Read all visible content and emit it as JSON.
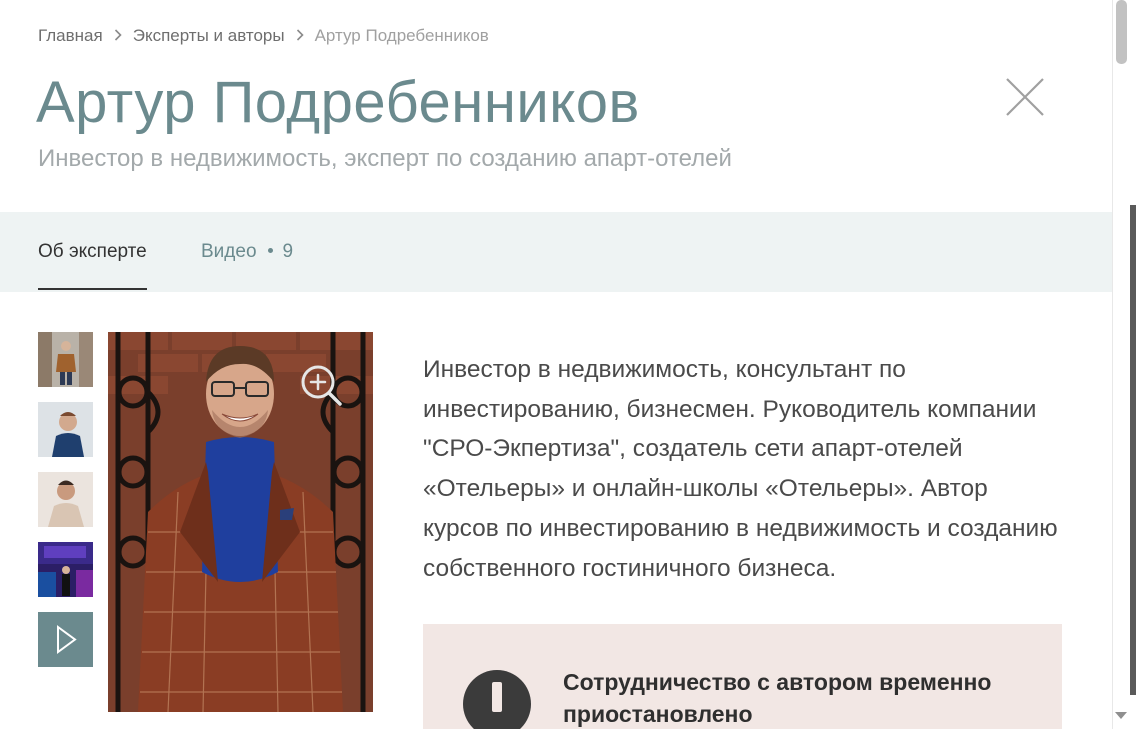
{
  "breadcrumb": {
    "items": [
      "Главная",
      "Эксперты и авторы",
      "Артур Подребенников"
    ],
    "separator": ">"
  },
  "expert": {
    "name": "Артур Подребенников",
    "subtitle": "Инвестор в недвижимость, эксперт по созданию апарт-отелей"
  },
  "tabs": {
    "about_label": "Об эксперте",
    "video_label": "Видео",
    "video_count": "9",
    "active": "about"
  },
  "gallery": {
    "thumbnails": [
      "photo-1",
      "photo-2",
      "photo-3",
      "photo-4",
      "video"
    ],
    "selected": "photo-1"
  },
  "description": "Инвестор в недвижимость, консультант по инвестированию, бизнесмен. Руководитель компании \"СРО-Экпертиза\", создатель сети апарт-отелей «Отельеры» и онлайн-школы «Отельеры». Автор курсов по инвестированию в недвижимость и созданию собственного гостиничного бизнеса.",
  "notice": {
    "text": "Сотрудничество с автором временно приостановлено",
    "icon": "exclamation-icon"
  },
  "colors": {
    "accent": "#6b8a8e",
    "tabs_bg": "#eef3f3",
    "notice_bg": "#f2e7e4",
    "text": "#4a4a4a"
  },
  "icons": {
    "close": "close-icon",
    "zoom": "zoom-in-icon",
    "play": "play-icon",
    "chevron": "chevron-right-icon"
  }
}
